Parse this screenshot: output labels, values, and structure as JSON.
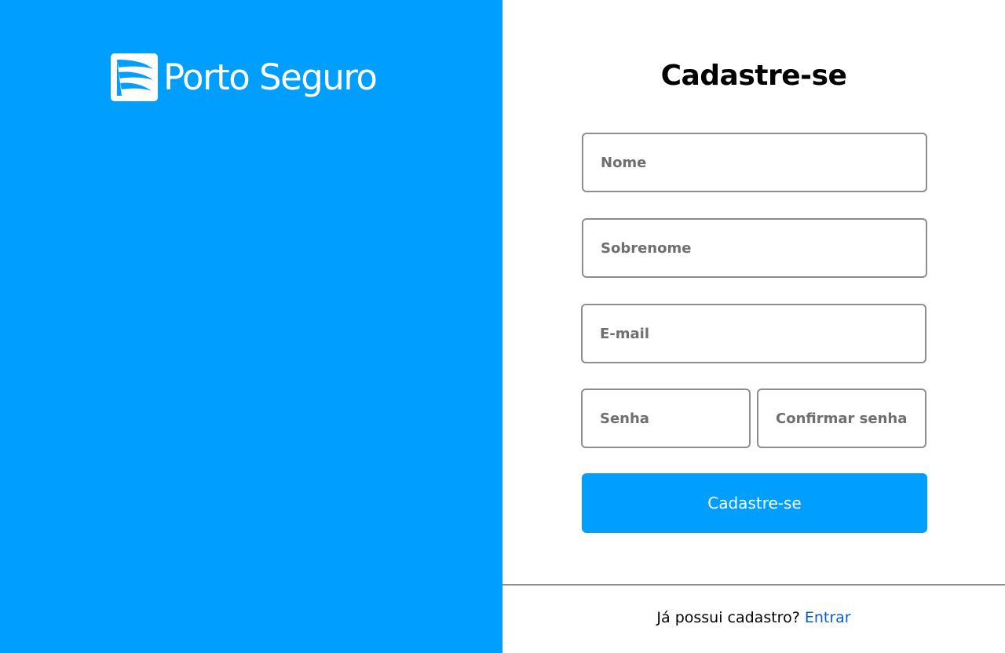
{
  "brand": {
    "name": "Porto Seguro",
    "primary_color": "#009FFF",
    "logo_icon": "porto-seguro-sail-icon"
  },
  "form": {
    "title": "Cadastre-se",
    "fields": {
      "nome": {
        "placeholder": "Nome",
        "value": ""
      },
      "sobrenome": {
        "placeholder": "Sobrenome",
        "value": ""
      },
      "email": {
        "placeholder": "E-mail",
        "value": ""
      },
      "senha": {
        "placeholder": "Senha",
        "value": ""
      },
      "confirmar_senha": {
        "placeholder": "Confirmar senha",
        "value": ""
      }
    },
    "submit_label": "Cadastre-se"
  },
  "footer": {
    "prompt": "Já possui cadastro?",
    "link_label": "Entrar",
    "link_color": "#0B5CC9"
  }
}
